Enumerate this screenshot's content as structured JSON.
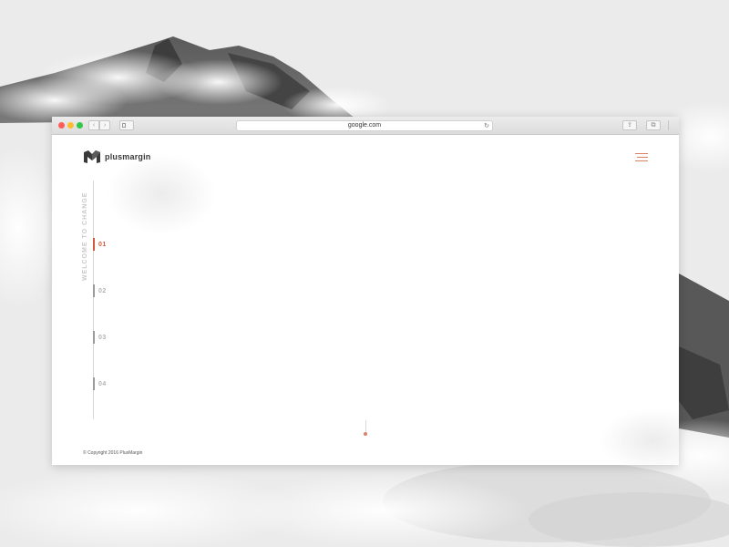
{
  "browser": {
    "url": "google.com"
  },
  "site": {
    "logo_text": "plusmargin",
    "tagline": "WELCOME TO CHANGE",
    "steps": [
      {
        "label": "01",
        "active": true
      },
      {
        "label": "02",
        "active": false
      },
      {
        "label": "03",
        "active": false
      },
      {
        "label": "04",
        "active": false
      }
    ],
    "copyright": "© Copyright 2016 PlusMargin"
  },
  "colors": {
    "accent": "#d25a3b",
    "menu": "#d9826b",
    "inactive_step": "#b3b3b3"
  },
  "icons": {
    "menu": "hamburger-menu-icon",
    "reload": "reload-icon",
    "share": "share-icon",
    "tabs": "tabs-overview-icon"
  }
}
